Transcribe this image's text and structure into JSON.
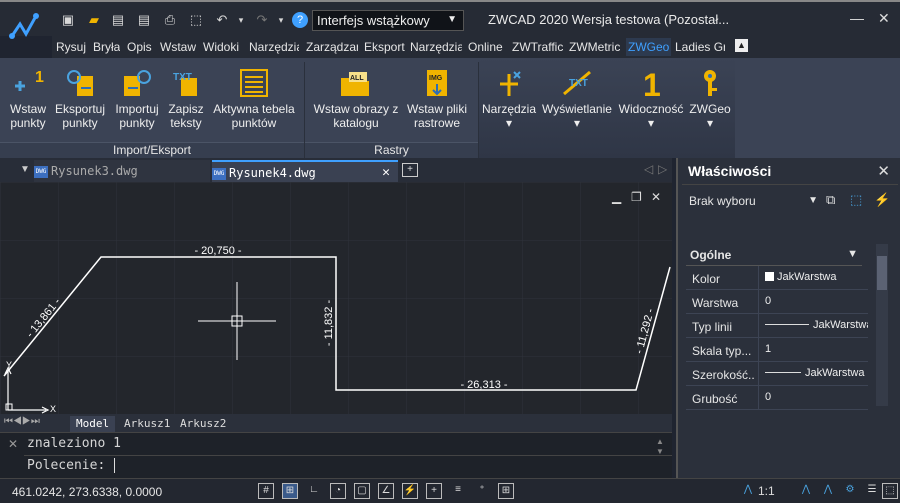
{
  "window": {
    "title": "ZWCAD 2020 Wersja testowa (Pozostał...",
    "workspace": "Interfejs wstążkowy"
  },
  "menu": [
    {
      "label": "Rysuj"
    },
    {
      "label": "Bryła"
    },
    {
      "label": "Opis"
    },
    {
      "label": "Wstaw"
    },
    {
      "label": "Widoki"
    },
    {
      "label": "Narzędzia"
    },
    {
      "label": "Zarządzanie"
    },
    {
      "label": "Eksport"
    },
    {
      "label": "Narzędzia"
    },
    {
      "label": "Online"
    },
    {
      "label": "ZWTraffic"
    },
    {
      "label": "ZWMetric"
    },
    {
      "label": "ZWGeo"
    },
    {
      "label": "Ladies Gr"
    }
  ],
  "ribbon": {
    "buttons": [
      {
        "label": "Wstaw punkty"
      },
      {
        "label": "Eksportuj punkty"
      },
      {
        "label": "Importuj punkty"
      },
      {
        "label": "Zapisz teksty"
      },
      {
        "label": "Aktywna tebela punktów"
      },
      {
        "label": "Wstaw obrazy z katalogu"
      },
      {
        "label": "Wstaw pliki rastrowe"
      },
      {
        "label": "Narzędzia"
      },
      {
        "label": "Wyświetlanie"
      },
      {
        "label": "Widoczność"
      },
      {
        "label": "ZWGeo"
      }
    ],
    "panels": [
      {
        "label": "Import/Eksport"
      },
      {
        "label": "Rastry"
      }
    ],
    "icon_text": {
      "all": "ALL",
      "img": "IMG",
      "txt": "TXT",
      "one": "1"
    }
  },
  "doc_tabs": [
    {
      "label": "Rysunek3.dwg",
      "active": false
    },
    {
      "label": "Rysunek4.dwg",
      "active": true
    }
  ],
  "drawing": {
    "dimensions": {
      "top": "20,750",
      "bottom": "26,313",
      "left_diag": "13,861",
      "middle_vert": "11,832",
      "right_diag": "11,292"
    },
    "ucs": {
      "x": "X",
      "y": "Y"
    }
  },
  "layout_tabs": [
    {
      "label": "Model",
      "active": true
    },
    {
      "label": "Arkusz1",
      "active": false
    },
    {
      "label": "Arkusz2",
      "active": false
    }
  ],
  "command": {
    "history": "znaleziono 1",
    "prompt": "Polecenie:"
  },
  "properties": {
    "title": "Właściwości",
    "selection": "Brak wyboru",
    "section": "Ogólne",
    "rows": [
      {
        "name": "Kolor",
        "value": "JakWarstwa",
        "swatch": "#ffffff"
      },
      {
        "name": "Warstwa",
        "value": "0"
      },
      {
        "name": "Typ linii",
        "value": "JakWarstwa"
      },
      {
        "name": "Skala typ...",
        "value": "1"
      },
      {
        "name": "Szerokość...",
        "value": "JakWarstwa"
      },
      {
        "name": "Grubość",
        "value": "0"
      }
    ]
  },
  "status": {
    "coords": "461.0242, 273.6338, 0.0000",
    "scale": "1:1"
  },
  "colors": {
    "accent": "#3fa0ff",
    "icon_yellow": "#f0b400",
    "icon_blue": "#4aa3df"
  }
}
